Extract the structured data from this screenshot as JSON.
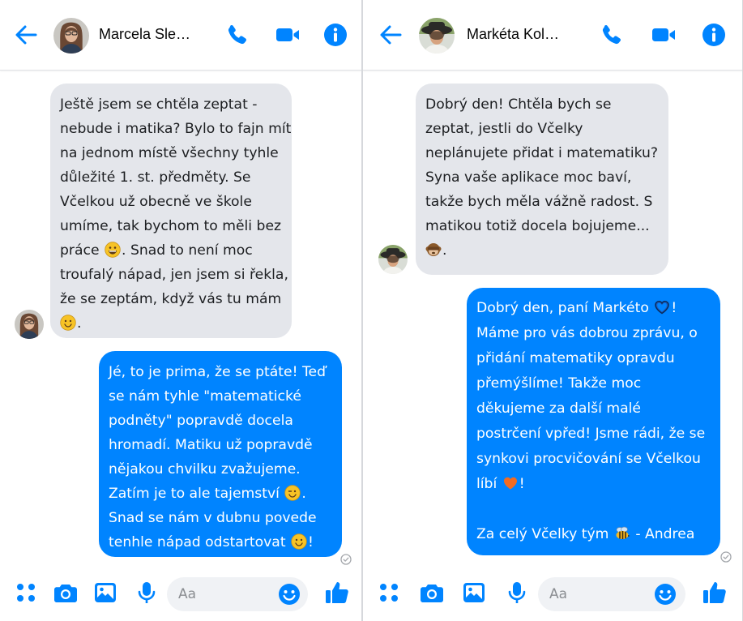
{
  "colors": {
    "accent": "#0084ff",
    "incoming_bubble": "#e4e6eb",
    "outgoing_text": "#ffffff"
  },
  "left": {
    "contact_name": "Marcela Sle…",
    "incoming_message": {
      "lines": [
        "Ještě jsem se chtěla zeptat -",
        "nebude i matika? Bylo to fajn mít",
        "na jednom místě všechny tyhle",
        "důležité 1. st. předměty. Se",
        "Včelkou už obecně ve škole",
        "umíme, tak bychom to měli bez",
        "práce",
        ". Snad to není moc",
        "troufalý nápad, jen jsem si řekla,",
        "že se zeptám, když vás tu mám",
        "."
      ]
    },
    "outgoing_message": {
      "lines": [
        "Jé, to je prima, že se ptáte! Teď",
        "se nám tyhle \"matematické",
        "podněty\" popravdě docela",
        "hromadí. Matiku už popravdě",
        "nějakou chvilku zvažujeme.",
        "Zatím je to ale tajemství",
        ".",
        "Snad se nám v dubnu povede",
        "tenhle nápad odstartovat",
        "!"
      ]
    },
    "composer_placeholder": "Aa"
  },
  "right": {
    "contact_name": "Markéta Kol…",
    "incoming_message": {
      "lines": [
        "Dobrý den! Chtěla bych se",
        "zeptat, jestli do Včelky",
        "neplánujete přidat i matematiku?",
        "Syna vaše aplikace moc baví,",
        "takže bych měla vážně radost. S",
        "matikou totiž docela bojujeme...",
        "."
      ]
    },
    "outgoing_message": {
      "lines": [
        "Dobrý den, paní Markéto",
        "!",
        "Máme pro vás dobrou zprávu, o",
        "přidání matematiky opravdu",
        "přemýšlíme! Takže moc",
        "děkujeme za další malé",
        "postrčení vpřed! Jsme rádi, že se",
        "synkovi procvičování se Včelkou",
        "líbí",
        "!",
        "",
        "Za celý Včelky tým",
        "- Andrea"
      ]
    },
    "composer_placeholder": "Aa"
  }
}
